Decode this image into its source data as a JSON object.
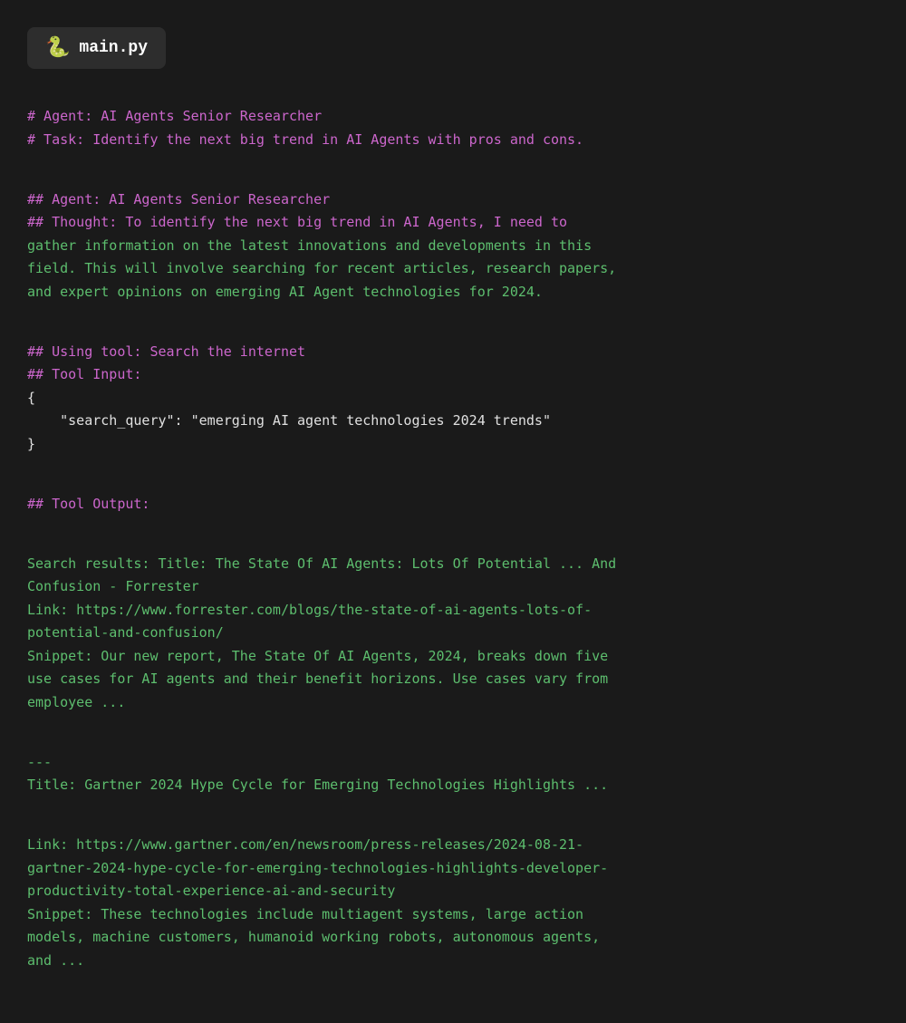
{
  "tab": {
    "icon": "🐍",
    "filename": "main.py"
  },
  "code": {
    "comment1": "# Agent: AI Agents Senior Researcher",
    "comment2": "# Task: Identify the next big trend in AI Agents with pros and cons.",
    "heading_agent": "## Agent: AI Agents Senior Researcher",
    "heading_thought": "## Thought: To identify the next big trend in AI Agents, I need to",
    "thought_line2": "gather information on the latest innovations and developments in this",
    "thought_line3": "field. This will involve searching for recent articles, research papers,",
    "thought_line4": "and expert opinions on emerging AI Agent technologies for 2024.",
    "using_tool": "## Using tool: Search the internet",
    "tool_input": "## Tool Input:",
    "json_open": "{",
    "json_content": "    \"search_query\": \"emerging AI agent technologies 2024 trends\"",
    "json_close": "}",
    "tool_output": "## Tool Output:",
    "result_title1": "Search results: Title: The State Of AI Agents: Lots Of Potential ... And",
    "result_title1b": "Confusion - Forrester",
    "result_link1": "Link: https://www.forrester.com/blogs/the-state-of-ai-agents-lots-of-",
    "result_link1b": "potential-and-confusion/",
    "result_snippet1": "Snippet: Our new report, The State Of AI Agents, 2024, breaks down five",
    "result_snippet1b": "use cases for AI agents and their benefit horizons. Use cases vary from",
    "result_snippet1c": "employee ...",
    "separator": "---",
    "result_title2": "Title: Gartner 2024 Hype Cycle for Emerging Technologies Highlights ...",
    "result_link2": "Link: https://www.gartner.com/en/newsroom/press-releases/2024-08-21-",
    "result_link2b": "gartner-2024-hype-cycle-for-emerging-technologies-highlights-developer-",
    "result_link2c": "productivity-total-experience-ai-and-security",
    "result_snippet2": "Snippet: These technologies include multiagent systems, large action",
    "result_snippet2b": "models, machine customers, humanoid working robots, autonomous agents,",
    "result_snippet2c": "and ..."
  }
}
